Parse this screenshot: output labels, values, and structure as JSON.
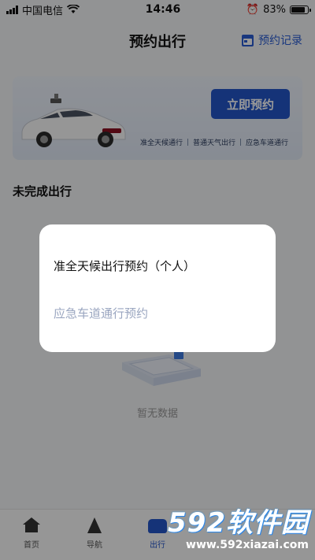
{
  "status_bar": {
    "carrier": "中国电信",
    "time": "14:46",
    "battery": "83%",
    "battery_level": 0.83
  },
  "header": {
    "title": "预约出行",
    "records_link": "预约记录"
  },
  "banner": {
    "reserve_button": "立即预约",
    "tags": [
      "准全天候通行",
      "普通天气出行",
      "应急车道通行"
    ]
  },
  "section": {
    "title": "未完成出行"
  },
  "empty_state": {
    "text": "暂无数据"
  },
  "tab_bar": {
    "items": [
      {
        "label": "首页",
        "icon": "home-icon"
      },
      {
        "label": "导航",
        "icon": "navigation-icon"
      },
      {
        "label": "出行",
        "icon": "trip-icon"
      },
      {
        "label": "",
        "icon": ""
      },
      {
        "label": "",
        "icon": ""
      }
    ],
    "active_index": 2
  },
  "modal": {
    "options": [
      {
        "label": "准全天候出行预约（个人）"
      },
      {
        "label": "应急车道通行预约"
      }
    ]
  },
  "watermark": {
    "brand": "592软件园",
    "url": "www.592xiazai.com"
  },
  "colors": {
    "accent": "#2456c8",
    "disabled_text": "#9aa6c0",
    "overlay": "rgba(0,0,0,0.4)"
  }
}
